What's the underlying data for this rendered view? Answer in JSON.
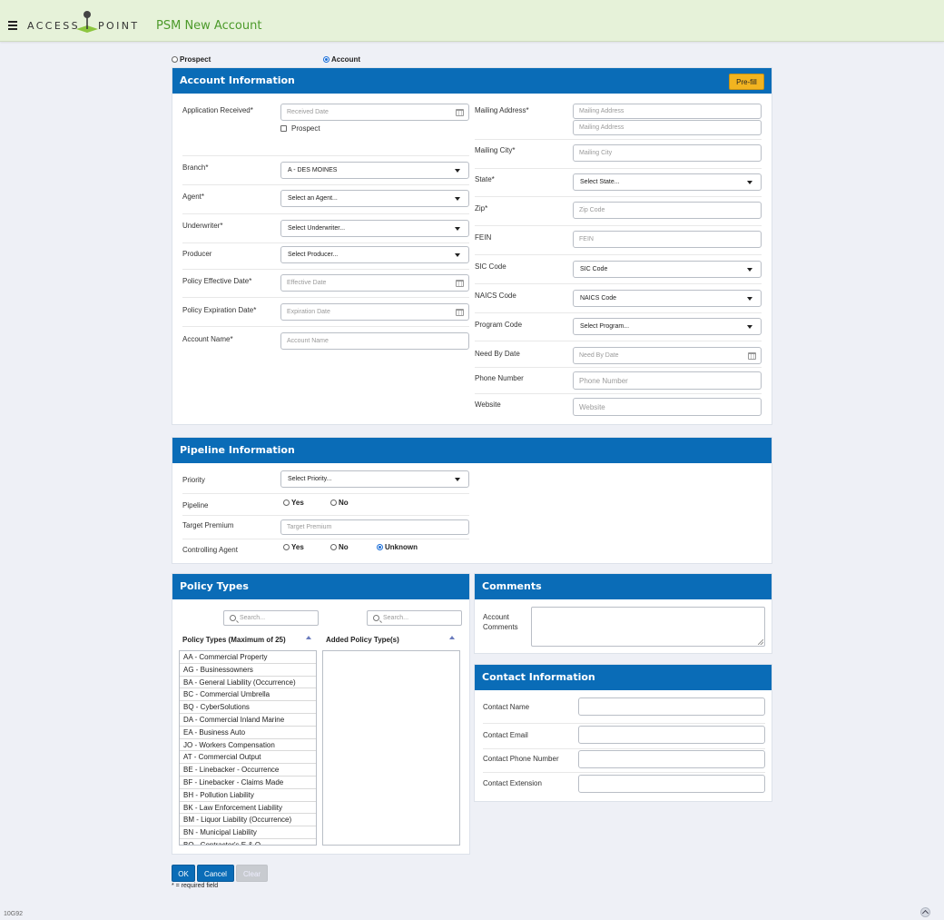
{
  "header": {
    "logo_left": "ACCESS",
    "logo_right": "POINT",
    "title": "PSM New Account"
  },
  "mode": {
    "prospect_label": "Prospect",
    "account_label": "Account",
    "selected": "Account"
  },
  "account": {
    "title": "Account Information",
    "prefill_label": "Pre-fill",
    "left": {
      "application_received_label": "Application Received*",
      "received_date_placeholder": "Received Date",
      "prospect_checkbox_label": "Prospect",
      "branch_label": "Branch*",
      "branch_value": "A - DES MOINES",
      "agent_label": "Agent*",
      "agent_value": "Select an Agent...",
      "underwriter_label": "Underwriter*",
      "underwriter_value": "Select Underwriter...",
      "producer_label": "Producer",
      "producer_value": "Select Producer...",
      "effective_label": "Policy Effective Date*",
      "effective_placeholder": "Effective Date",
      "expiration_label": "Policy Expiration Date*",
      "expiration_placeholder": "Expiration Date",
      "account_name_label": "Account Name*",
      "account_name_placeholder": "Account Name"
    },
    "right": {
      "mailing_address_label": "Mailing Address*",
      "mailing_address_placeholder": "Mailing Address",
      "mailing_address2_placeholder": "Mailing Address",
      "mailing_city_label": "Mailing City*",
      "mailing_city_placeholder": "Mailing City",
      "state_label": "State*",
      "state_value": "Select State...",
      "zip_label": "Zip*",
      "zip_placeholder": "Zip Code",
      "fein_label": "FEIN",
      "fein_placeholder": "FEIN",
      "sic_label": "SIC Code",
      "sic_value": "SIC Code",
      "naics_label": "NAICS Code",
      "naics_value": "NAICS Code",
      "program_label": "Program Code",
      "program_value": "Select Program...",
      "need_by_label": "Need By Date",
      "need_by_placeholder": "Need By Date",
      "phone_label": "Phone Number",
      "phone_placeholder": "Phone Number",
      "website_label": "Website",
      "website_placeholder": "Website"
    }
  },
  "pipeline": {
    "title": "Pipeline Information",
    "priority_label": "Priority",
    "priority_value": "Select Priority...",
    "pipeline_label": "Pipeline",
    "yes_label": "Yes",
    "no_label": "No",
    "target_premium_label": "Target Premium",
    "target_premium_placeholder": "Target Premium",
    "controlling_agent_label": "Controlling Agent",
    "ca_yes_label": "Yes",
    "ca_no_label": "No",
    "ca_unknown_label": "Unknown",
    "controlling_agent_selected": "Unknown"
  },
  "policy_types": {
    "title": "Policy Types",
    "search_placeholder": "Search...",
    "search2_placeholder": "Search...",
    "available_header": "Policy Types (Maximum of 25)",
    "added_header": "Added Policy Type(s)",
    "items": [
      "AA - Commercial Property",
      "AG - Businessowners",
      "BA - General Liability (Occurrence)",
      "BC - Commercial Umbrella",
      "BQ - CyberSolutions",
      "DA - Commercial Inland Marine",
      "EA - Business Auto",
      "JO - Workers Compensation",
      "AT - Commercial Output",
      "BE - Linebacker - Occurrence",
      "BF - Linebacker - Claims Made",
      "BH - Pollution Liability",
      "BK - Law Enforcement Liability",
      "BM - Liquor Liability (Occurrence)",
      "BN - Municipal Liability",
      "BO - Contractor's E & O"
    ]
  },
  "comments": {
    "title": "Comments",
    "label_line1": "Account",
    "label_line2": "Comments"
  },
  "contact": {
    "title": "Contact Information",
    "name_label": "Contact Name",
    "email_label": "Contact Email",
    "phone_label": "Contact Phone Number",
    "extension_label": "Contact Extension"
  },
  "actions": {
    "ok_label": "OK",
    "cancel_label": "Cancel",
    "clear_label": "Clear",
    "required_note": "* = required field"
  },
  "footer": {
    "version": "10G92"
  }
}
